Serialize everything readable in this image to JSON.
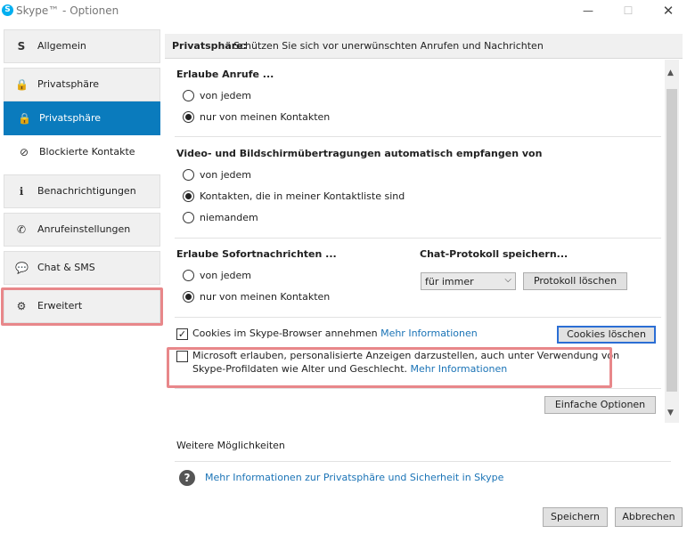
{
  "window": {
    "title": "Skype™ - Optionen",
    "app_icon": "S",
    "minimize_icon": "—",
    "maximize_icon": "☐",
    "close_icon": "✕"
  },
  "sidebar": {
    "items": [
      {
        "label": "Allgemein",
        "icon": "skype-icon",
        "glyph": "S"
      },
      {
        "label": "Privatsphäre",
        "icon": "lock-icon",
        "glyph": "🔒"
      },
      {
        "label": "Privatsphäre",
        "icon": "lock-icon",
        "glyph": "🔒"
      },
      {
        "label": "Blockierte Kontakte",
        "icon": "blocked-icon",
        "glyph": "⊘"
      },
      {
        "label": "Benachrichtigungen",
        "icon": "info-icon",
        "glyph": "ℹ"
      },
      {
        "label": "Anrufeinstellungen",
        "icon": "phone-icon",
        "glyph": "✆"
      },
      {
        "label": "Chat & SMS",
        "icon": "chat-icon",
        "glyph": "💬"
      },
      {
        "label": "Erweitert",
        "icon": "gear-icon",
        "glyph": "⚙"
      }
    ]
  },
  "panel": {
    "header_strong": "Privatsphäre:",
    "header_rest": "Schützen Sie sich vor unerwünschten Anrufen und Nachrichten",
    "calls": {
      "title": "Erlaube Anrufe ...",
      "options": [
        "von jedem",
        "nur von meinen Kontakten"
      ],
      "selected": 1
    },
    "video": {
      "title": "Video- und Bildschirmübertragungen automatisch empfangen von",
      "options": [
        "von jedem",
        "Kontakten, die in meiner Kontaktliste sind",
        "niemandem"
      ],
      "selected": 1
    },
    "im": {
      "title": "Erlaube Sofortnachrichten ...",
      "options": [
        "von jedem",
        "nur von meinen Kontakten"
      ],
      "selected": 1
    },
    "chat_history": {
      "title": "Chat-Protokoll speichern...",
      "select_value": "für immer",
      "arrow": "⌵",
      "clear_button": "Protokoll löschen"
    },
    "cookies": {
      "checked": true,
      "check_mark": "✓",
      "label": "Cookies im Skype-Browser annehmen",
      "link": "Mehr Informationen",
      "button": "Cookies löschen"
    },
    "ads": {
      "checked": false,
      "line1": "Microsoft erlauben, personalisierte Anzeigen darzustellen, auch unter Verwendung von",
      "line2": "Skype-Profildaten wie Alter und Geschlecht.",
      "link": "Mehr Informationen"
    },
    "simple_options_button": "Einfache Optionen",
    "more_title": "Weitere Möglichkeiten",
    "help_icon": "?",
    "help_link": "Mehr Informationen zur Privatsphäre und Sicherheit in Skype",
    "scroll_up": "▲",
    "scroll_down": "▼"
  },
  "footer": {
    "save": "Speichern",
    "cancel": "Abbrechen"
  },
  "colors": {
    "active_nav": "#0a7bbd",
    "highlight": "#e8878a",
    "link": "#1a73b6"
  }
}
